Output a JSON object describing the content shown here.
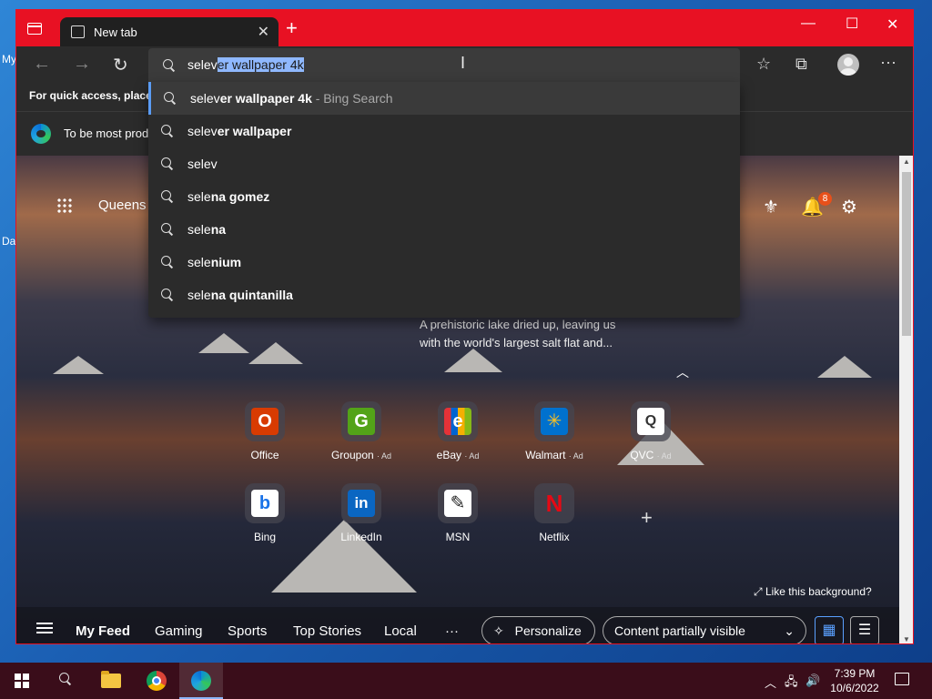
{
  "desktop": {
    "label_top": "My",
    "label_bottom": "Da"
  },
  "browser": {
    "tab_title": "New tab",
    "address_typed": "selev",
    "address_selected": "er wallpaper 4k",
    "favbar_text": "For quick access, place y",
    "infobar_text": "To be most prod",
    "suggestions": [
      {
        "prefix": "selev",
        "bold": "er wallpaper 4k",
        "hint": " - Bing Search"
      },
      {
        "prefix": "selev",
        "bold": "er wallpaper",
        "hint": ""
      },
      {
        "prefix": "selev",
        "bold": "",
        "hint": ""
      },
      {
        "prefix": "sele",
        "bold": "na gomez",
        "hint": ""
      },
      {
        "prefix": "sele",
        "bold": "na",
        "hint": ""
      },
      {
        "prefix": "sele",
        "bold": "nium",
        "hint": ""
      },
      {
        "prefix": "sele",
        "bold": "na quintanilla",
        "hint": ""
      }
    ]
  },
  "newtab": {
    "location": "Queens",
    "notification_count": "8",
    "caption_line1": "A prehistoric lake dried up, leaving us",
    "caption_line2": "with the world's largest salt flat and...",
    "tiles": [
      {
        "label": "Office",
        "ad": "",
        "glyph": "O",
        "color": "#d83b01"
      },
      {
        "label": "Groupon",
        "ad": "· Ad",
        "glyph": "G",
        "color": "#53a318"
      },
      {
        "label": "eBay",
        "ad": "· Ad",
        "glyph": "e",
        "color": "#333333"
      },
      {
        "label": "Walmart",
        "ad": "· Ad",
        "glyph": "✳",
        "color": "#0071ce"
      },
      {
        "label": "QVC",
        "ad": "· Ad",
        "glyph": "Q",
        "color": "#ffffff"
      },
      {
        "label": "Bing",
        "ad": "",
        "glyph": "b",
        "color": "#ffffff"
      },
      {
        "label": "LinkedIn",
        "ad": "",
        "glyph": "in",
        "color": "#0a66c2"
      },
      {
        "label": "MSN",
        "ad": "",
        "glyph": "✎",
        "color": "#ffffff"
      },
      {
        "label": "Netflix",
        "ad": "",
        "glyph": "N",
        "color": "#e50914"
      }
    ],
    "like_background": "Like this background?",
    "feed_tabs": [
      "My Feed",
      "Gaming",
      "Sports",
      "Top Stories",
      "Local",
      "···"
    ],
    "personalize": "Personalize",
    "content_visibility": "Content partially visible"
  },
  "taskbar": {
    "time": "7:39 PM",
    "date": "10/6/2022"
  },
  "colors": {
    "accent_red": "#e81123",
    "selection": "#8fb8ff",
    "taskbar": "#3a0d1a"
  }
}
